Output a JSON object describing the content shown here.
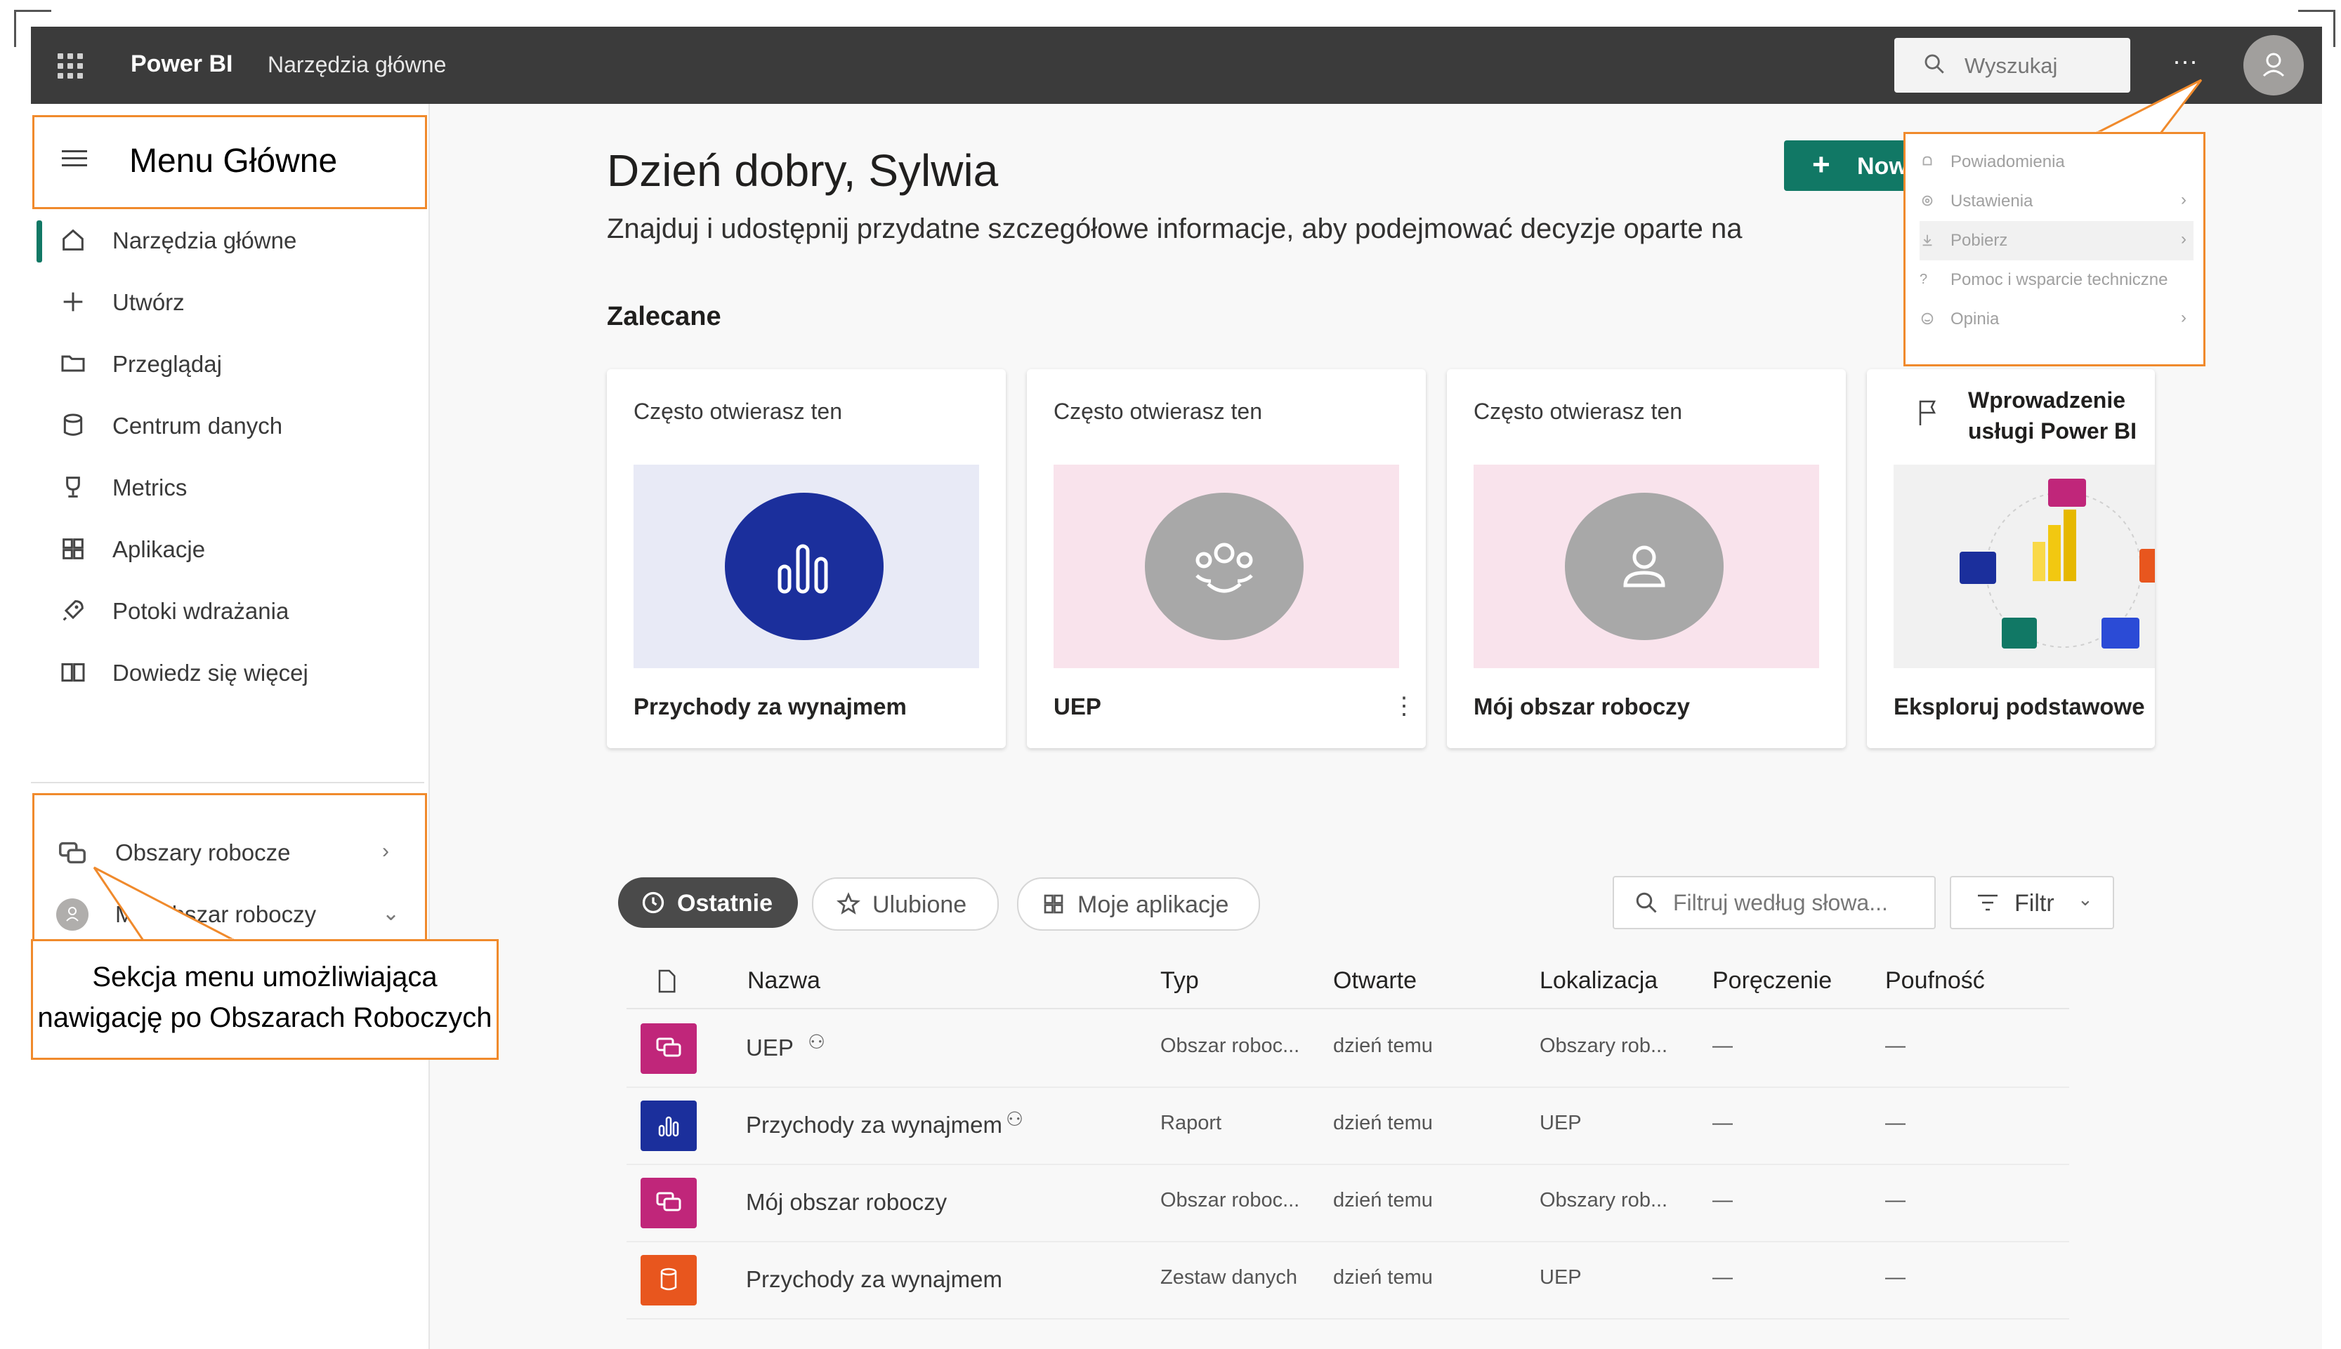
{
  "topbar": {
    "brand": "Power BI",
    "breadcrumb": "Narzędzia główne",
    "search_placeholder": "Wyszukaj",
    "more_label": "...",
    "bg": "#3b3b3b"
  },
  "sidebar": {
    "menu_label": "Menu Główne",
    "items": [
      {
        "label": "Narzędzia główne",
        "icon": "home-icon",
        "active": true
      },
      {
        "label": "Utwórz",
        "icon": "plus-icon"
      },
      {
        "label": "Przeglądaj",
        "icon": "folder-icon"
      },
      {
        "label": "Centrum danych",
        "icon": "database-icon"
      },
      {
        "label": "Metrics",
        "icon": "trophy-icon"
      },
      {
        "label": "Aplikacje",
        "icon": "apps-icon"
      },
      {
        "label": "Potoki wdrażania",
        "icon": "rocket-icon"
      },
      {
        "label": "Dowiedz się więcej",
        "icon": "book-icon"
      }
    ],
    "workspaces": [
      {
        "label": "Obszary robocze",
        "icon": "workspaces-icon",
        "chevron": "›"
      },
      {
        "label": "Mój obszar roboczy",
        "icon": "user-avatar-icon",
        "chevron": "⌄"
      }
    ]
  },
  "callout": {
    "text": "Sekcja menu umożliwiająca nawigację po Obszarach Roboczych"
  },
  "main": {
    "greeting": "Dzień dobry, Sylwia",
    "subtitle": "Znajduj i udostępnij przydatne szczegółowe informacje, aby podejmować decyzje oparte na",
    "new_button": "Nowy",
    "recommended_title": "Zalecane",
    "cards": [
      {
        "hint": "Często otwierasz ten",
        "name": "Przychody za wynajmem",
        "icon": "report-icon",
        "thumb_bg": "#e8eaf6",
        "circle": "#1b2f9c"
      },
      {
        "hint": "Często otwierasz ten",
        "name": "UEP",
        "icon": "group-icon",
        "thumb_bg": "#f9e3ec",
        "circle": "#a8a8a8",
        "menu": "⋮"
      },
      {
        "hint": "Często otwierasz ten",
        "name": "Mój obszar roboczy",
        "icon": "person-icon",
        "thumb_bg": "#f9e3ec",
        "circle": "#a8a8a8"
      },
      {
        "title_line1": "Wprowadzenie",
        "title_line2": "usługi Power BI",
        "name": "Eksploruj podstawowe",
        "icon": "flag-icon"
      }
    ],
    "pills": [
      {
        "label": "Ostatnie",
        "icon": "clock-icon"
      },
      {
        "label": "Ulubione",
        "icon": "star-icon"
      },
      {
        "label": "Moje aplikacje",
        "icon": "apps-icon"
      }
    ],
    "filter_placeholder": "Filtruj według słowa...",
    "filter_button": "Filtr",
    "table": {
      "headers": [
        "Nazwa",
        "Typ",
        "Otwarte",
        "Lokalizacja",
        "Poręczenie",
        "Poufność"
      ],
      "rows": [
        {
          "name": "UEP",
          "type": "Obszar roboc...",
          "opened": "dzień temu",
          "location": "Obszary rob...",
          "endorsement": "—",
          "sensitivity": "—",
          "badge": "#c0267a",
          "icon": "workspace-icon"
        },
        {
          "name": "Przychody za wynajmem",
          "type": "Raport",
          "opened": "dzień temu",
          "location": "UEP",
          "endorsement": "—",
          "sensitivity": "—",
          "badge": "#1b2f9c",
          "icon": "report-icon"
        },
        {
          "name": "Mój obszar roboczy",
          "type": "Obszar roboc...",
          "opened": "dzień temu",
          "location": "Obszary rob...",
          "endorsement": "—",
          "sensitivity": "—",
          "badge": "#c0267a",
          "icon": "workspace-icon"
        },
        {
          "name": "Przychody za wynajmem",
          "type": "Zestaw danych",
          "opened": "dzień temu",
          "location": "UEP",
          "endorsement": "—",
          "sensitivity": "—",
          "badge": "#e8561e",
          "icon": "dataset-icon"
        }
      ]
    }
  },
  "dropdown": {
    "items": [
      {
        "label": "Powiadomienia",
        "icon": "bell-icon"
      },
      {
        "label": "Ustawienia",
        "icon": "gear-icon",
        "chevron": "›"
      },
      {
        "label": "Pobierz",
        "icon": "download-icon",
        "chevron": "›"
      },
      {
        "label": "Pomoc i wsparcie techniczne",
        "icon": "help-icon",
        "chevron": "›"
      },
      {
        "label": "Opinia",
        "icon": "feedback-icon",
        "chevron": "›"
      }
    ]
  },
  "colors": {
    "accent": "#117865",
    "highlight": "#f08a2c"
  }
}
